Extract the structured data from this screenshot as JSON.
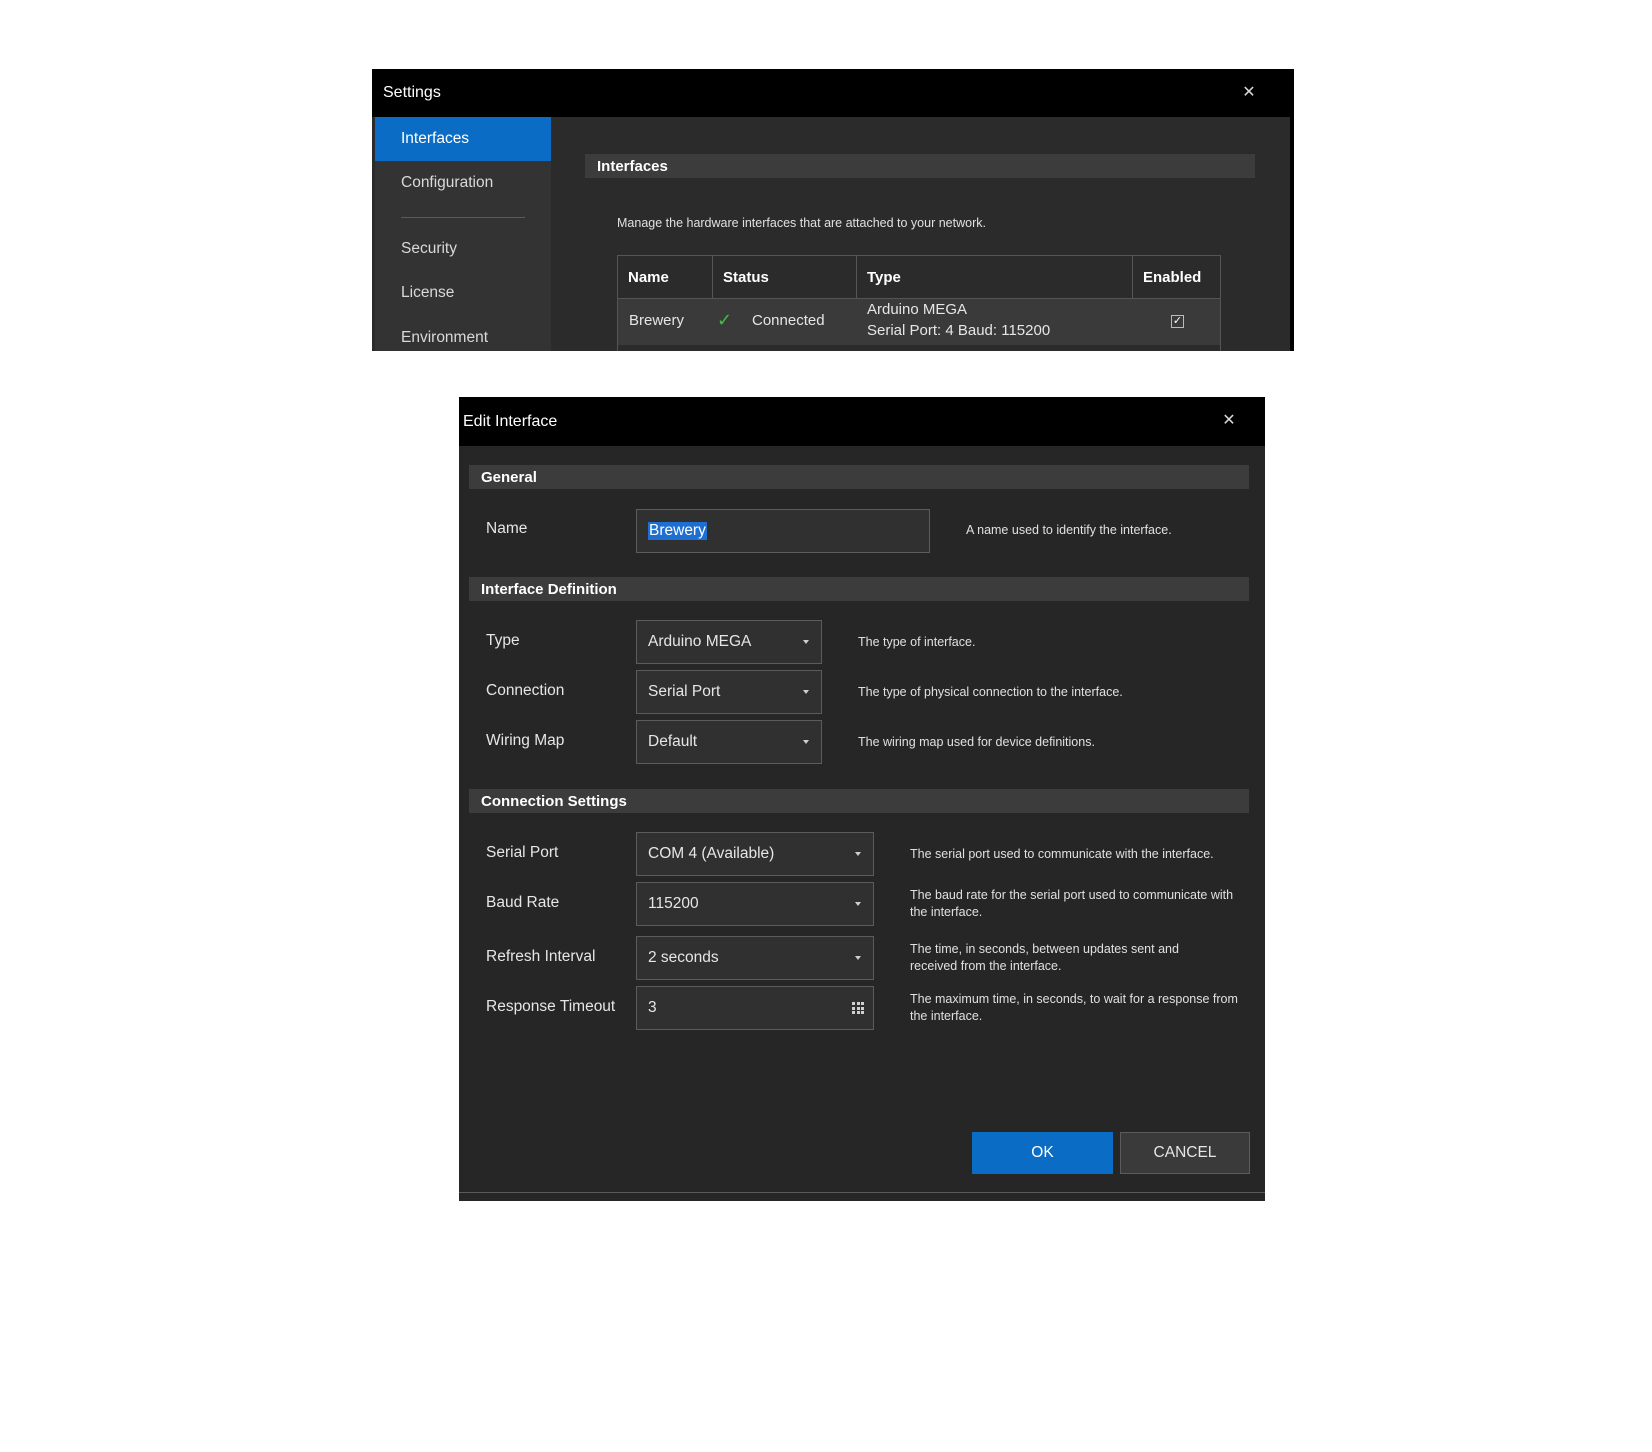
{
  "settings": {
    "title": "Settings",
    "sidebar": {
      "items": [
        {
          "label": "Interfaces",
          "active": true
        },
        {
          "label": "Configuration"
        },
        {
          "label": "Security"
        },
        {
          "label": "License"
        },
        {
          "label": "Environment"
        }
      ]
    },
    "interfaces": {
      "header": "Interfaces",
      "description": "Manage the hardware interfaces that are attached to your network.",
      "table": {
        "columns": [
          "Name",
          "Status",
          "Type",
          "Enabled"
        ],
        "rows": [
          {
            "name": "Brewery",
            "status": "Connected",
            "type_line1": "Arduino MEGA",
            "type_line2": "Serial Port: 4 Baud: 115200",
            "enabled": "✓"
          }
        ]
      }
    }
  },
  "edit": {
    "title": "Edit Interface",
    "sections": {
      "general": "General",
      "definition": "Interface Definition",
      "connection": "Connection Settings"
    },
    "fields": {
      "name": {
        "label": "Name",
        "value": "Brewery",
        "help": "A name used to identify the interface."
      },
      "type": {
        "label": "Type",
        "value": "Arduino MEGA",
        "help": "The type of interface."
      },
      "connection": {
        "label": "Connection",
        "value": "Serial Port",
        "help": "The type of physical connection to the interface."
      },
      "wiring": {
        "label": "Wiring Map",
        "value": "Default",
        "help": "The wiring map used for device definitions."
      },
      "serial_port": {
        "label": "Serial Port",
        "value": "COM 4 (Available)",
        "help": "The serial port used to communicate with the interface."
      },
      "baud": {
        "label": "Baud Rate",
        "value": "115200",
        "help": "The baud rate for the serial port used to communicate with the interface."
      },
      "refresh": {
        "label": "Refresh Interval",
        "value": "2 seconds",
        "help": "The time, in seconds, between updates sent and received from the interface."
      },
      "timeout": {
        "label": "Response Timeout",
        "value": "3",
        "help": "The maximum time, in seconds, to wait for a response from the interface."
      }
    },
    "buttons": {
      "ok": "OK",
      "cancel": "CANCEL"
    }
  },
  "colors": {
    "accent": "#0a6cc5",
    "status_ok": "#3ec23e",
    "titlebar": "#000000"
  }
}
